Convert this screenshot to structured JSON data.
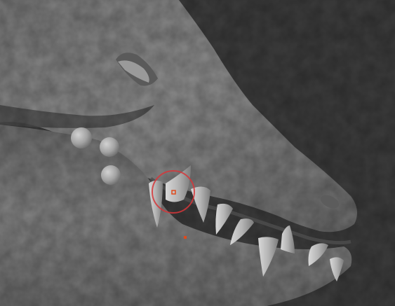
{
  "viewport": {
    "background_color": "#3d3d3d",
    "mesh_color": "#8d8d8d",
    "tooth_color": "#bdbdbd"
  },
  "brush": {
    "ring_color": "#d6363a",
    "marker_color": "#e04a1c"
  }
}
